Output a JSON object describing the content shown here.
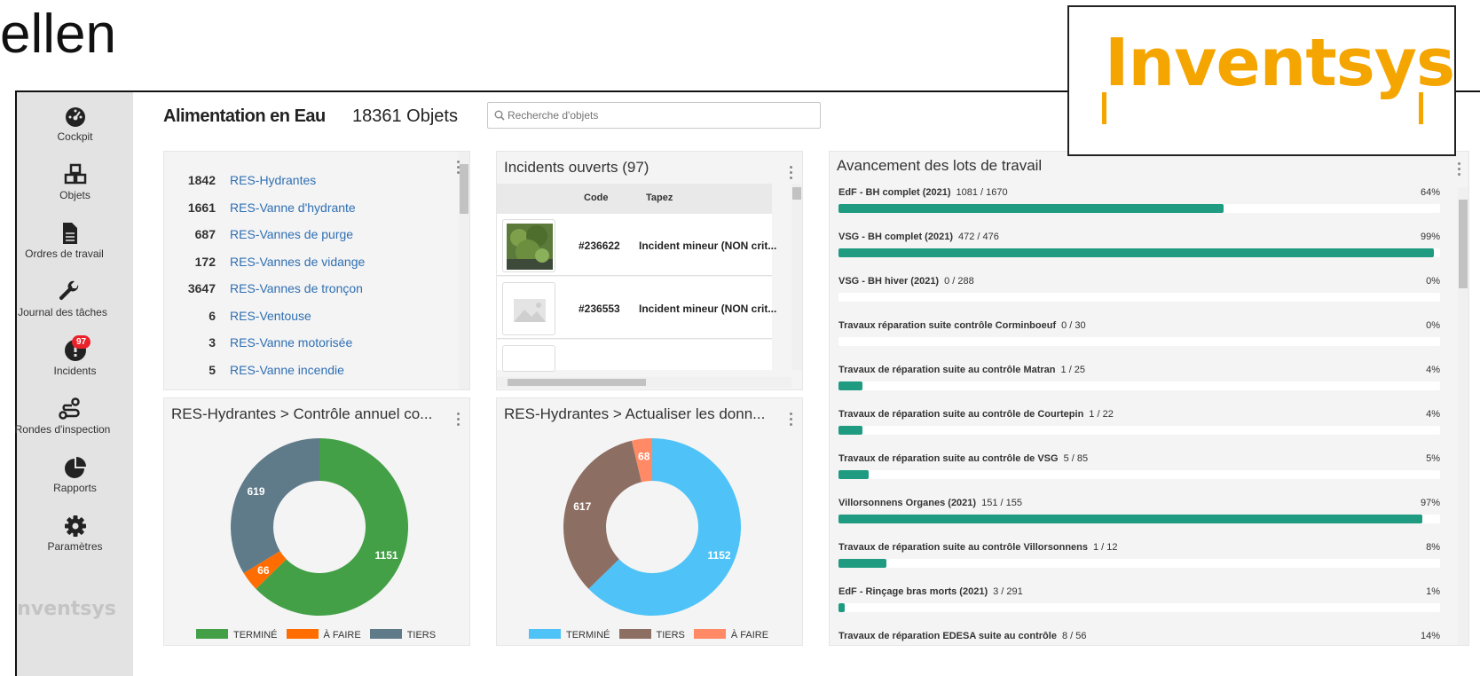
{
  "slide": {
    "title": "ellen",
    "logo": "Inventsys"
  },
  "sidebar": {
    "items": [
      {
        "label": "Cockpit",
        "icon": "dashboard-icon"
      },
      {
        "label": "Objets",
        "icon": "cubes-icon"
      },
      {
        "label": "Ordres de travail",
        "icon": "document-icon"
      },
      {
        "label": "Journal des tâches",
        "icon": "wrench-icon"
      },
      {
        "label": "Incidents",
        "icon": "alert-icon",
        "badge": "97"
      },
      {
        "label": "Rondes d'inspection",
        "icon": "route-icon"
      },
      {
        "label": "Rapports",
        "icon": "pie-icon"
      },
      {
        "label": "Paramètres",
        "icon": "gear-icon"
      }
    ],
    "logo": "Inventsys"
  },
  "header": {
    "title": "Alimentation en Eau",
    "count": "18361 Objets",
    "search_placeholder": "Recherche d'objets"
  },
  "objects": [
    {
      "count": "1842",
      "name": "RES-Hydrantes"
    },
    {
      "count": "1661",
      "name": "RES-Vanne d'hydrante"
    },
    {
      "count": "687",
      "name": "RES-Vannes de purge"
    },
    {
      "count": "172",
      "name": "RES-Vannes de vidange"
    },
    {
      "count": "3647",
      "name": "RES-Vannes de tronçon"
    },
    {
      "count": "6",
      "name": "RES-Ventouse"
    },
    {
      "count": "3",
      "name": "RES-Vanne motorisée"
    },
    {
      "count": "5",
      "name": "RES-Vanne incendie"
    }
  ],
  "incidents": {
    "title": "Incidents ouverts (97)",
    "col_code": "Code",
    "col_type": "Tapez",
    "rows": [
      {
        "code": "#236622",
        "type": "Incident mineur (NON crit..."
      },
      {
        "code": "#236553",
        "type": "Incident mineur (NON crit..."
      }
    ]
  },
  "lots": {
    "title": "Avancement des lots de travail",
    "items": [
      {
        "name": "EdF - BH complet (2021)",
        "progress": "1081 / 1670",
        "pct": "64%",
        "value": 64
      },
      {
        "name": "VSG - BH complet (2021)",
        "progress": "472 / 476",
        "pct": "99%",
        "value": 99
      },
      {
        "name": "VSG - BH hiver (2021)",
        "progress": "0 / 288",
        "pct": "0%",
        "value": 0
      },
      {
        "name": "Travaux réparation suite contrôle Corminboeuf",
        "progress": "0 / 30",
        "pct": "0%",
        "value": 0
      },
      {
        "name": "Travaux de réparation suite au contrôle Matran",
        "progress": "1 / 25",
        "pct": "4%",
        "value": 4
      },
      {
        "name": "Travaux de réparation suite au contrôle de Courtepin",
        "progress": "1 / 22",
        "pct": "4%",
        "value": 4
      },
      {
        "name": "Travaux de réparation suite au contrôle de VSG",
        "progress": "5 / 85",
        "pct": "5%",
        "value": 5
      },
      {
        "name": "Villorsonnens Organes (2021)",
        "progress": "151 / 155",
        "pct": "97%",
        "value": 97
      },
      {
        "name": "Travaux de réparation suite au contrôle Villorsonnens",
        "progress": "1 / 12",
        "pct": "8%",
        "value": 8
      },
      {
        "name": "EdF - Rinçage bras morts (2021)",
        "progress": "3 / 291",
        "pct": "1%",
        "value": 1
      },
      {
        "name": "Travaux de réparation EDESA suite au contrôle",
        "progress": "8 / 56",
        "pct": "14%",
        "value": 14
      }
    ]
  },
  "chart_data": [
    {
      "type": "pie",
      "title": "RES-Hydrantes > Contrôle annuel co...",
      "series": [
        {
          "name": "TERMINÉ",
          "value": 1151,
          "color": "#43a047"
        },
        {
          "name": "À FAIRE",
          "value": 66,
          "color": "#ff6d00"
        },
        {
          "name": "TIERS",
          "value": 619,
          "color": "#5f7a89"
        }
      ]
    },
    {
      "type": "pie",
      "title": "RES-Hydrantes > Actualiser les donn...",
      "series": [
        {
          "name": "TERMINÉ",
          "value": 1152,
          "color": "#4fc3f7"
        },
        {
          "name": "TIERS",
          "value": 617,
          "color": "#8d6e63"
        },
        {
          "name": "À FAIRE",
          "value": 68,
          "color": "#ff8a65"
        }
      ]
    }
  ]
}
